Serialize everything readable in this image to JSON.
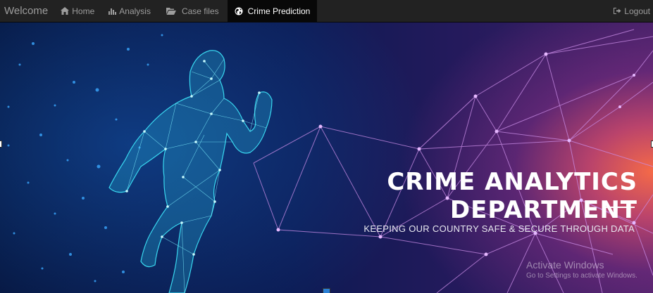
{
  "navbar": {
    "brand": "Welcome",
    "items": [
      {
        "label": "Home",
        "icon": "home-icon"
      },
      {
        "label": "Analysis",
        "icon": "bar-chart-icon"
      },
      {
        "label": "Case files",
        "icon": "folder-open-icon"
      },
      {
        "label": "Crime Prediction",
        "icon": "globe-icon",
        "active": true
      }
    ],
    "logout": {
      "label": "Logout",
      "icon": "logout-icon"
    }
  },
  "hero": {
    "title": "CRIME ANALYTICS DEPARTMENT",
    "subtitle": "KEEPING OUR COUNTRY SAFE & SECURE THROUGH DATA"
  },
  "watermark": {
    "title": "Activate Windows",
    "subtitle": "Go to Settings to activate Windows."
  },
  "colors": {
    "navbar_bg": "#222222",
    "active_tab_bg": "#080808",
    "hero_dark": "#0b1640",
    "hero_glow": "#ff6e46",
    "figure_cyan": "#39d8f0",
    "network_violet": "#c98ce6"
  }
}
